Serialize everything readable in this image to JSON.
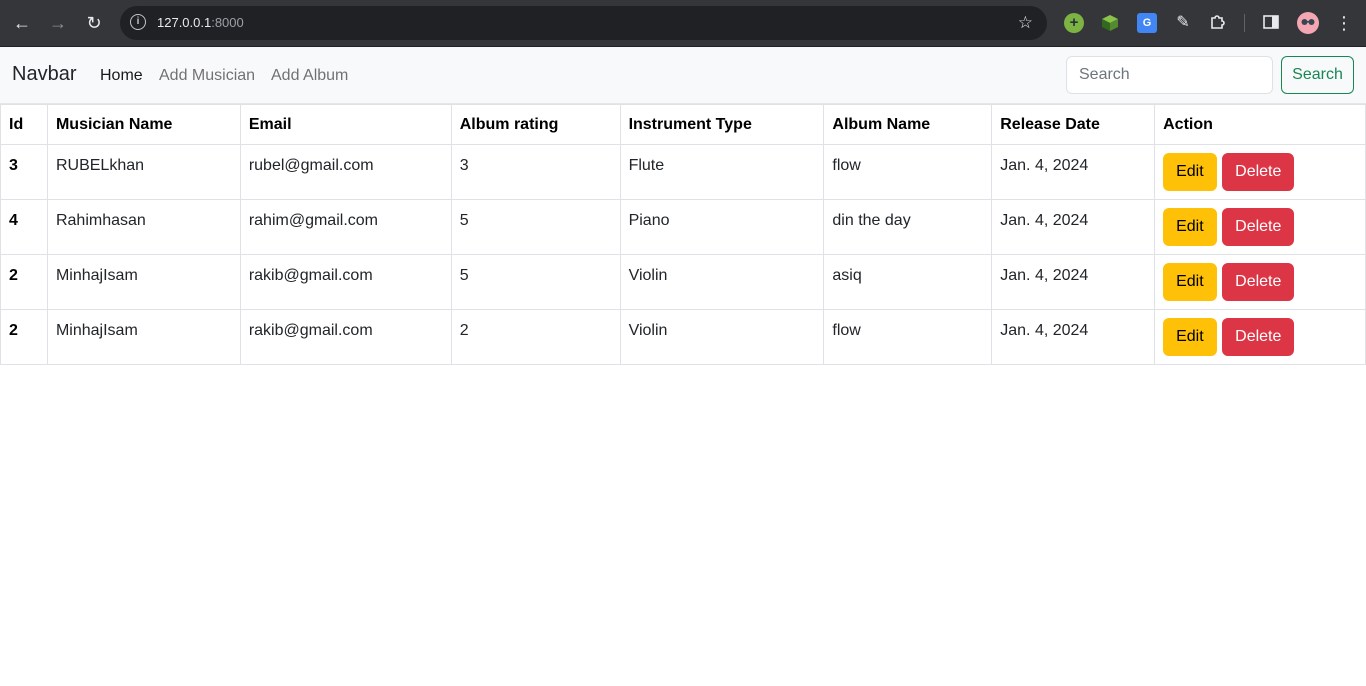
{
  "browser": {
    "url_host": "127.0.0.1",
    "url_port": ":8000"
  },
  "navbar": {
    "brand": "Navbar",
    "links": [
      "Home",
      "Add Musician",
      "Add Album"
    ],
    "search_placeholder": "Search",
    "search_button": "Search"
  },
  "table": {
    "headers": [
      "Id",
      "Musician Name",
      "Email",
      "Album rating",
      "Instrument Type",
      "Album Name",
      "Release Date",
      "Action"
    ],
    "rows": [
      {
        "id": "3",
        "name": "RUBELkhan",
        "email": "rubel@gmail.com",
        "rating": "3",
        "instrument": "Flute",
        "album": "flow",
        "date": "Jan. 4, 2024",
        "edit": "Edit",
        "delete": "Delete"
      },
      {
        "id": "4",
        "name": "Rahimhasan",
        "email": "rahim@gmail.com",
        "rating": "5",
        "instrument": "Piano",
        "album": "din the day",
        "date": "Jan. 4, 2024",
        "edit": "Edit",
        "delete": "Delete"
      },
      {
        "id": "2",
        "name": "MinhajIsam",
        "email": "rakib@gmail.com",
        "rating": "5",
        "instrument": "Violin",
        "album": "asiq",
        "date": "Jan. 4, 2024",
        "edit": "Edit",
        "delete": "Delete"
      },
      {
        "id": "2",
        "name": "MinhajIsam",
        "email": "rakib@gmail.com",
        "rating": "2",
        "instrument": "Violin",
        "album": "flow",
        "date": "Jan. 4, 2024",
        "edit": "Edit",
        "delete": "Delete"
      }
    ]
  },
  "colors": {
    "edit": "#ffc107",
    "delete": "#dc3545",
    "search_outline": "#198754"
  }
}
